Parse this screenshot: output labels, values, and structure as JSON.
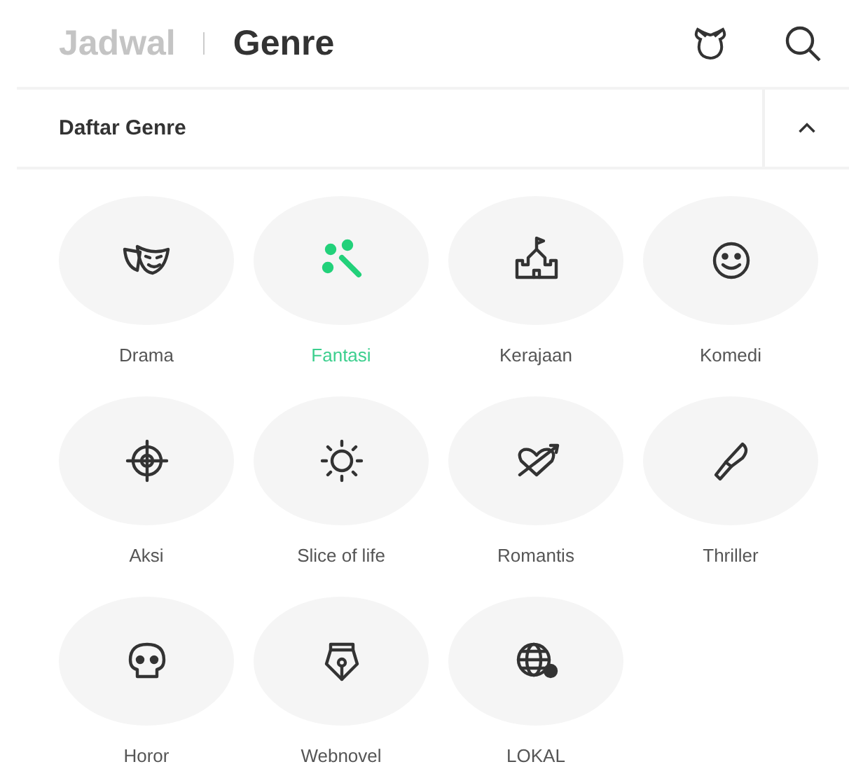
{
  "tabs": [
    {
      "label": "Jadwal",
      "selected": false
    },
    {
      "label": "Genre",
      "selected": true
    }
  ],
  "section": {
    "title": "Daftar Genre",
    "expanded": true
  },
  "genres": [
    {
      "label": "Drama",
      "selected": false
    },
    {
      "label": "Fantasi",
      "selected": true
    },
    {
      "label": "Kerajaan",
      "selected": false
    },
    {
      "label": "Komedi",
      "selected": false
    },
    {
      "label": "Aksi",
      "selected": false
    },
    {
      "label": "Slice of life",
      "selected": false
    },
    {
      "label": "Romantis",
      "selected": false
    },
    {
      "label": "Thriller",
      "selected": false
    },
    {
      "label": "Horor",
      "selected": false
    },
    {
      "label": "Webnovel",
      "selected": false
    },
    {
      "label": "LOKAL",
      "selected": false
    }
  ]
}
